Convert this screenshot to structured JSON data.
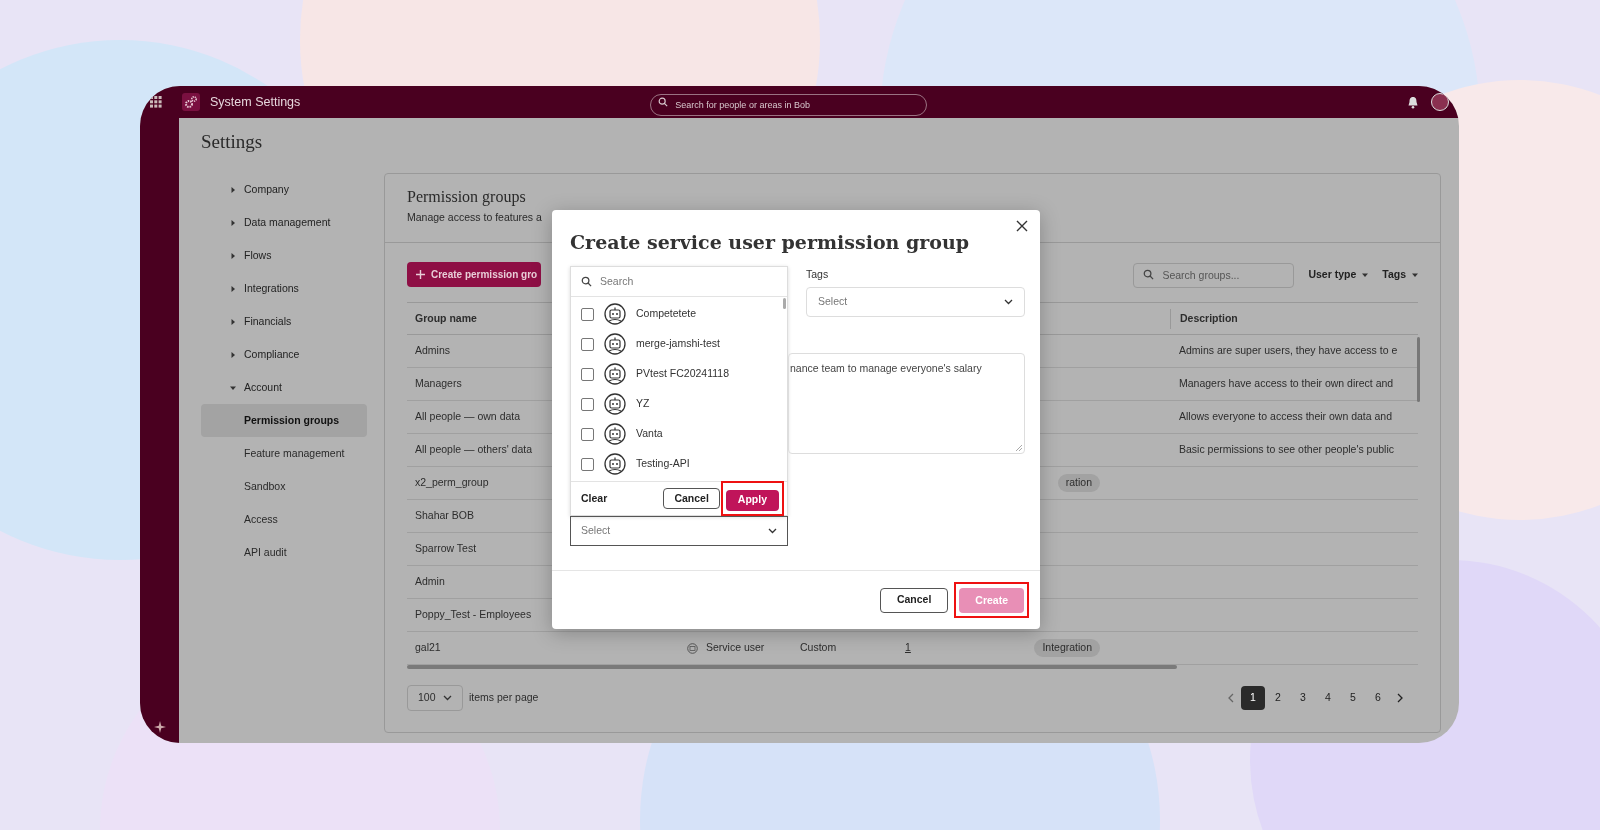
{
  "topbar": {
    "title": "System Settings",
    "search_placeholder": "Search for people or areas in Bob"
  },
  "page_title": "Settings",
  "nav": [
    {
      "label": "Company",
      "expanded": false
    },
    {
      "label": "Data management",
      "expanded": false
    },
    {
      "label": "Flows",
      "expanded": false
    },
    {
      "label": "Integrations",
      "expanded": false
    },
    {
      "label": "Financials",
      "expanded": false
    },
    {
      "label": "Compliance",
      "expanded": false
    },
    {
      "label": "Account",
      "expanded": true,
      "children": [
        {
          "label": "Permission groups",
          "selected": true
        },
        {
          "label": "Feature management",
          "selected": false
        },
        {
          "label": "Sandbox",
          "selected": false
        },
        {
          "label": "Access",
          "selected": false
        },
        {
          "label": "API audit",
          "selected": false
        }
      ]
    }
  ],
  "card": {
    "title": "Permission groups",
    "subtitle": "Manage access to features a",
    "create_button": "Create permission gro",
    "search_placeholder": "Search groups...",
    "filters": [
      "User type",
      "Tags"
    ],
    "table": {
      "columns": [
        "Group name",
        "Description"
      ],
      "rows": [
        {
          "name": "Admins",
          "description": "Admins are super users, they have access to e"
        },
        {
          "name": "Managers",
          "description": "Managers have access to their own direct and"
        },
        {
          "name": "All people — own data",
          "description": "Allows everyone to access their own data and"
        },
        {
          "name": "All people — others' data",
          "description": "Basic permissions to see other people's public"
        },
        {
          "name": "x2_perm_group",
          "tag": "ration"
        },
        {
          "name": "Shahar BOB"
        },
        {
          "name": "Sparrow Test"
        },
        {
          "name": "Admin"
        },
        {
          "name": "Poppy_Test - Employees"
        },
        {
          "name": "gal21",
          "user_type": "Service user",
          "type": "Custom",
          "count": "1",
          "tag": "Integration"
        }
      ]
    },
    "pagination": {
      "per_page": "100",
      "per_page_label": "items per page",
      "pages": [
        {
          "label": "1",
          "selected": true
        },
        {
          "label": "2",
          "selected": false
        },
        {
          "label": "3",
          "selected": false
        },
        {
          "label": "4",
          "selected": false
        },
        {
          "label": "5",
          "selected": false
        },
        {
          "label": "6",
          "selected": false
        }
      ]
    }
  },
  "modal": {
    "title": "Create service user permission group",
    "dropdown": {
      "search_placeholder": "Search",
      "options": [
        {
          "label": "Competetete",
          "checked": false
        },
        {
          "label": "merge-jamshi-test",
          "checked": false
        },
        {
          "label": "PVtest FC20241118",
          "checked": false
        },
        {
          "label": "YZ",
          "checked": false
        },
        {
          "label": "Vanta",
          "checked": false
        },
        {
          "label": "Testing-API",
          "checked": false
        }
      ],
      "clear": "Clear",
      "cancel": "Cancel",
      "apply": {
        "label": "Apply",
        "highlighted": true
      }
    },
    "user_select_placeholder": "Select",
    "tags": {
      "label": "Tags",
      "placeholder": "Select"
    },
    "description_value": "nance team to manage everyone's salary",
    "cancel": "Cancel",
    "create": {
      "label": "Create",
      "disabled": true,
      "highlighted": true
    }
  }
}
